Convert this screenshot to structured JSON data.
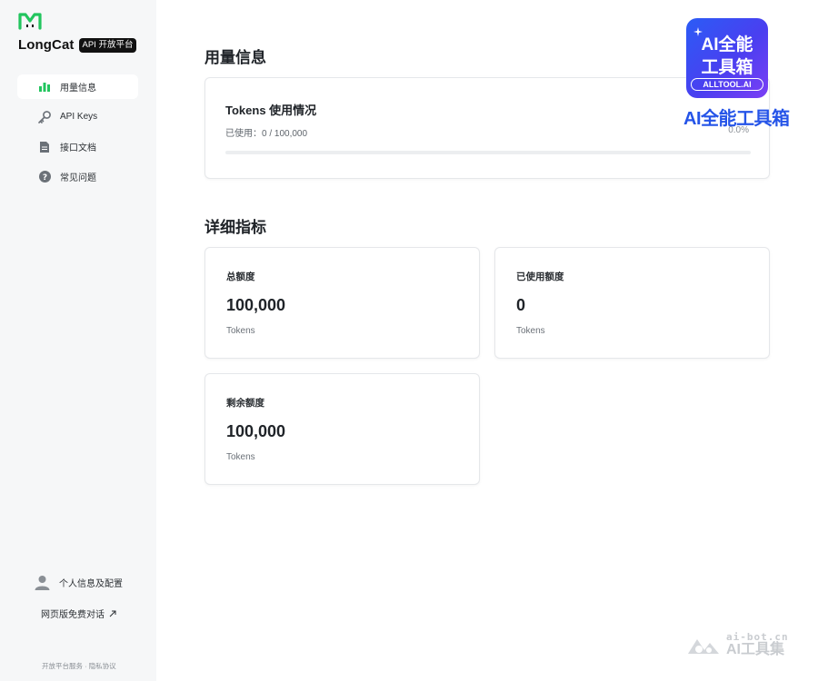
{
  "app": {
    "name": "LongCat",
    "badge": "API 开放平台"
  },
  "nav": {
    "items": [
      {
        "label": "用量信息",
        "icon": "bar-chart-icon",
        "active": true
      },
      {
        "label": "API Keys",
        "icon": "key-icon",
        "active": false
      },
      {
        "label": "接口文档",
        "icon": "document-icon",
        "active": false
      },
      {
        "label": "常见问题",
        "icon": "question-icon",
        "active": false
      }
    ]
  },
  "sidebar_footer": {
    "profile_label": "个人信息及配置",
    "web_chat_label": "网页版免费对话",
    "service_link": "开放平台服务",
    "separator": "·",
    "privacy_link": "隐私协议"
  },
  "usage": {
    "section_title": "用量信息",
    "card_title": "Tokens 使用情况",
    "used_text": "已使用：0 / 100,000",
    "percent_text": "0.0%",
    "progress_fraction": 0
  },
  "details": {
    "section_title": "详细指标",
    "metrics": [
      {
        "label": "总额度",
        "value": "100,000",
        "unit": "Tokens"
      },
      {
        "label": "已使用额度",
        "value": "0",
        "unit": "Tokens"
      },
      {
        "label": "剩余额度",
        "value": "100,000",
        "unit": "Tokens"
      }
    ]
  },
  "watermarks": {
    "alltool_line1": "AI全能",
    "alltool_line2": "工具箱",
    "alltool_domain": "ALLTOOL.AI",
    "alltool_text": "AI全能工具箱",
    "aibot_domain": "ai-bot.cn",
    "aibot_text": "AI工具集"
  },
  "colors": {
    "brand": "#22c55e",
    "sidebar_bg": "#f6f7f8",
    "watermark_blue": "#2554e8"
  }
}
